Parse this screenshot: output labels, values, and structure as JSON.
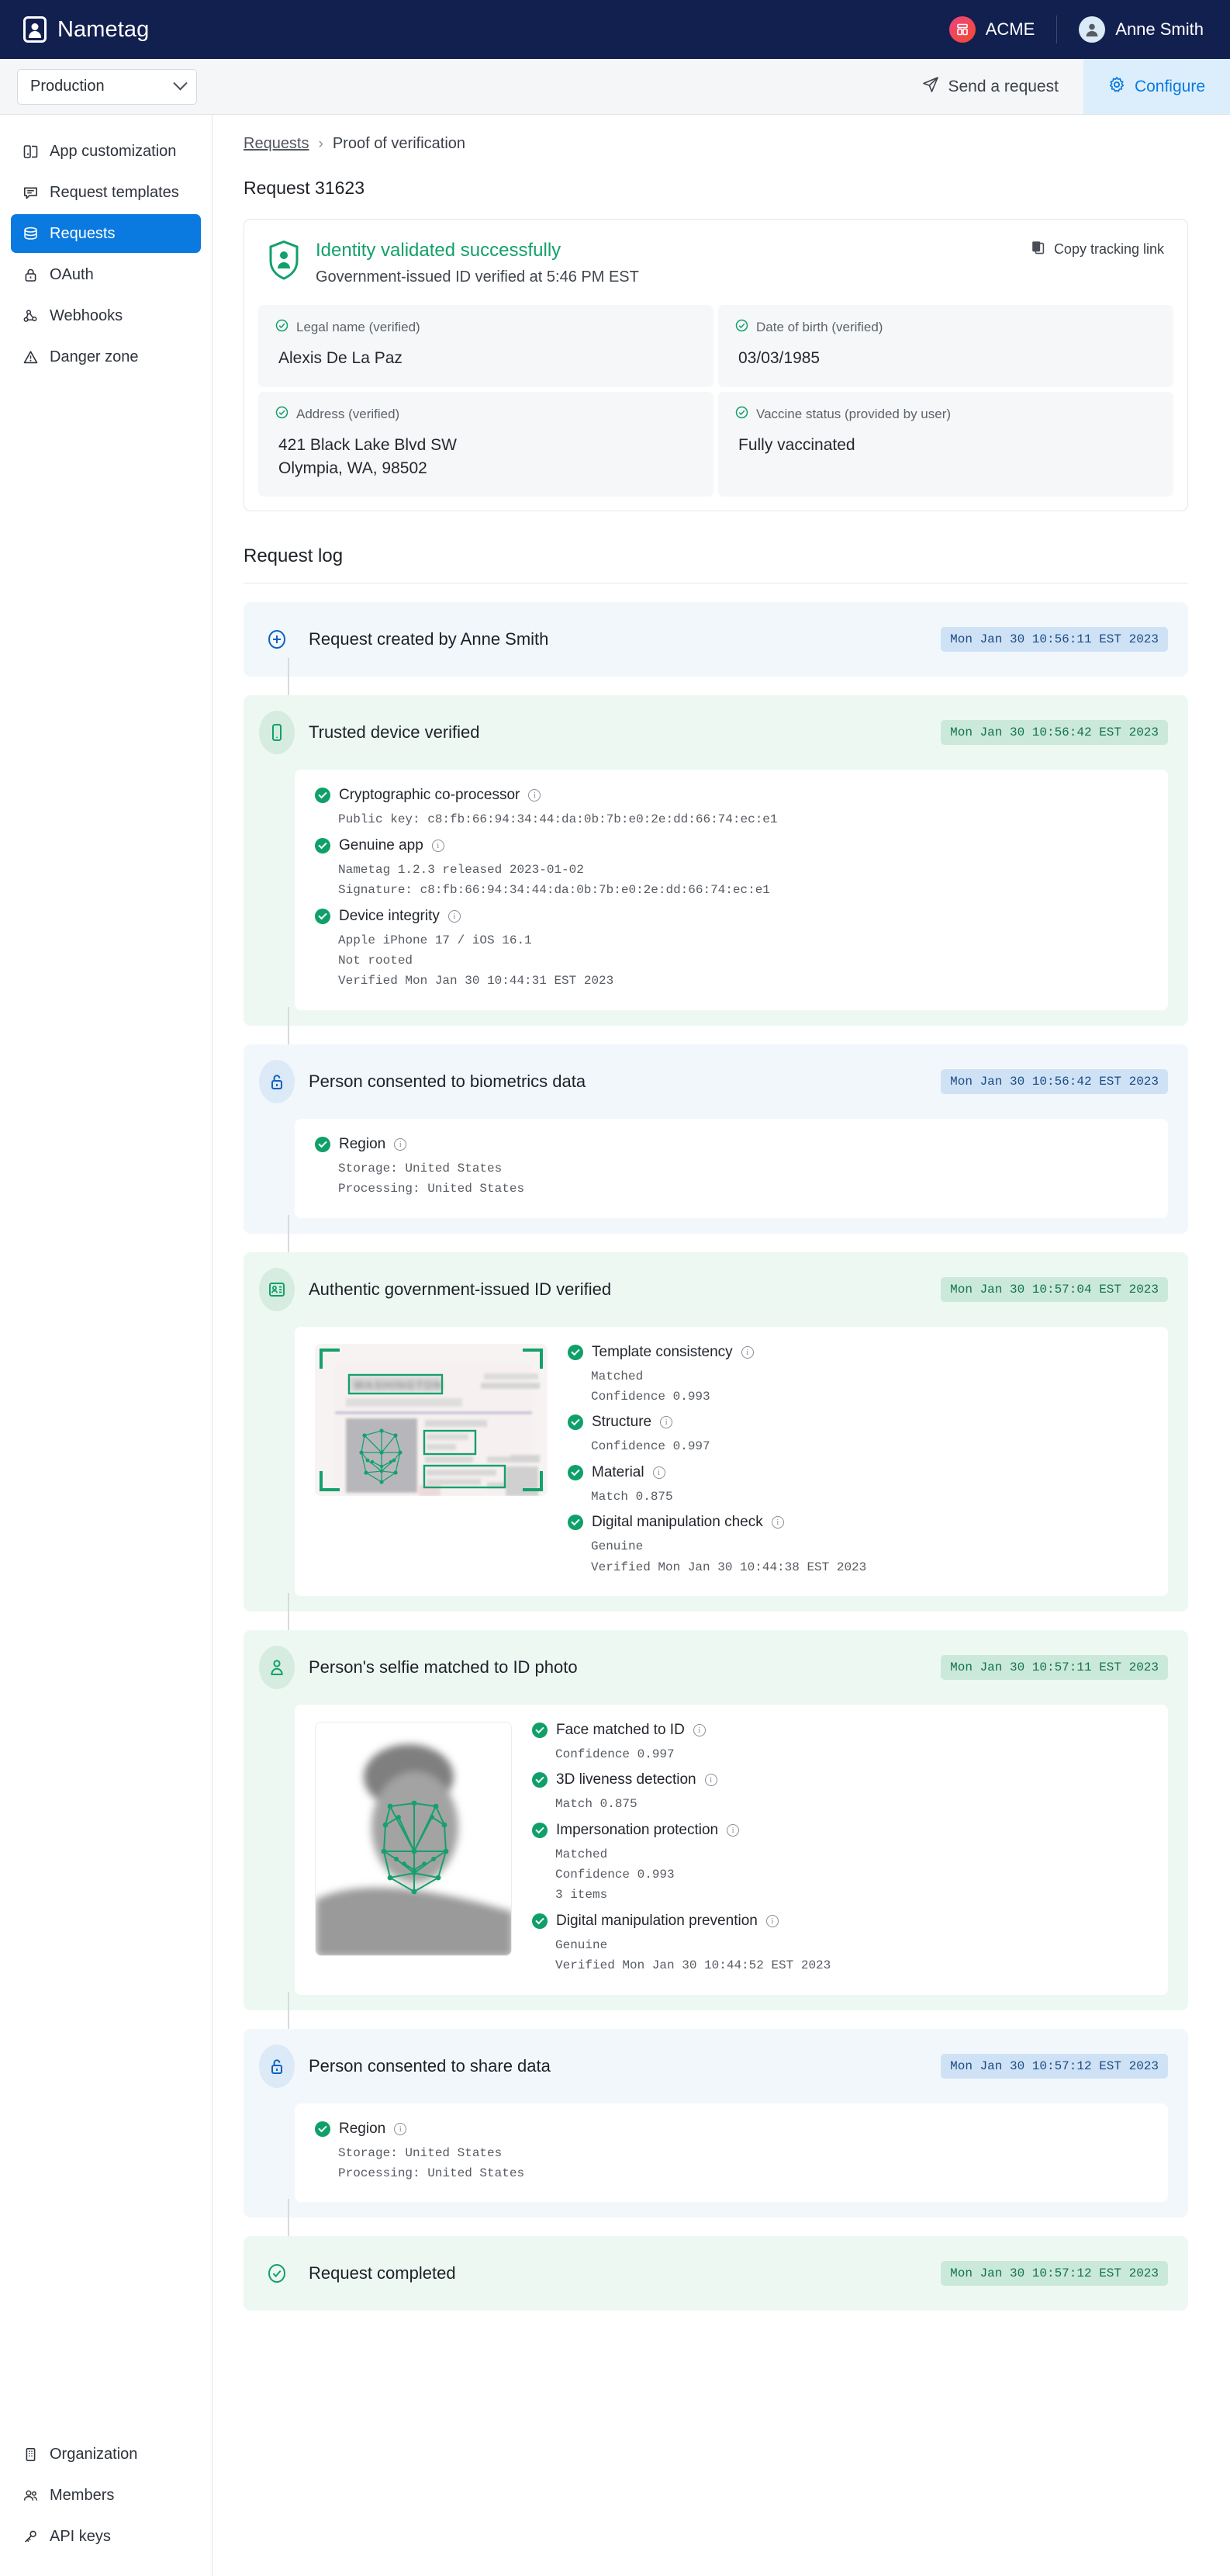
{
  "topbar": {
    "brand": "Nametag",
    "org": "ACME",
    "user": "Anne Smith"
  },
  "subbar": {
    "environment": "Production",
    "send_request": "Send a request",
    "configure": "Configure"
  },
  "sidebar": {
    "items": [
      {
        "label": "App customization",
        "icon": "layout-icon",
        "active": false
      },
      {
        "label": "Request templates",
        "icon": "message-icon",
        "active": false
      },
      {
        "label": "Requests",
        "icon": "database-icon",
        "active": true
      },
      {
        "label": "OAuth",
        "icon": "lock-icon",
        "active": false
      },
      {
        "label": "Webhooks",
        "icon": "webhook-icon",
        "active": false
      },
      {
        "label": "Danger zone",
        "icon": "warning-icon",
        "active": false
      }
    ],
    "bottom_items": [
      {
        "label": "Organization",
        "icon": "building-icon"
      },
      {
        "label": "Members",
        "icon": "people-icon"
      },
      {
        "label": "API keys",
        "icon": "key-icon"
      }
    ]
  },
  "breadcrumb": {
    "root": "Requests",
    "separator": "›",
    "current": "Proof of verification"
  },
  "page_title": "Request 31623",
  "verification_card": {
    "title": "Identity validated successfully",
    "subtitle": "Government-issued ID verified at 5:46 PM EST",
    "copy_link": "Copy tracking link",
    "fields": [
      {
        "label": "Legal name (verified)",
        "value": "Alexis De La Paz"
      },
      {
        "label": "Date of birth (verified)",
        "value": "03/03/1985"
      },
      {
        "label": "Address (verified)",
        "value": "421 Black Lake Blvd SW\nOlympia, WA, 98502"
      },
      {
        "label": "Vaccine status (provided by user)",
        "value": "Fully vaccinated"
      }
    ]
  },
  "request_log": {
    "section_title": "Request log",
    "events": [
      {
        "id": "request-created",
        "title": "Request created by Anne Smith",
        "time": "Mon Jan 30 10:56:11 EST 2023",
        "tone": "blue",
        "icon": "plus-circle-icon",
        "checks": []
      },
      {
        "id": "trusted-device",
        "title": "Trusted device verified",
        "time": "Mon Jan 30 10:56:42 EST 2023",
        "tone": "green",
        "icon": "phone-icon",
        "checks": [
          {
            "label": "Cryptographic co-processor",
            "lines": [
              "Public key: c8:fb:66:94:34:44:da:0b:7b:e0:2e:dd:66:74:ec:e1"
            ]
          },
          {
            "label": "Genuine app",
            "lines": [
              "Nametag 1.2.3 released 2023-01-02",
              "Signature: c8:fb:66:94:34:44:da:0b:7b:e0:2e:dd:66:74:ec:e1"
            ]
          },
          {
            "label": "Device integrity",
            "lines": [
              "Apple iPhone 17 / iOS 16.1",
              "Not rooted",
              "Verified Mon Jan 30 10:44:31 EST 2023"
            ]
          }
        ]
      },
      {
        "id": "consent-biometrics",
        "title": "Person consented to biometrics data",
        "time": "Mon Jan 30 10:56:42 EST 2023",
        "tone": "blue",
        "icon": "unlock-icon",
        "checks": [
          {
            "label": "Region",
            "lines": [
              "Storage: United States",
              "Processing: United States"
            ]
          }
        ]
      },
      {
        "id": "gov-id-verified",
        "title": "Authentic government-issued ID verified",
        "time": "Mon Jan 30 10:57:04 EST 2023",
        "tone": "green",
        "icon": "id-card-icon",
        "thumb": "id-document",
        "checks": [
          {
            "label": "Template consistency",
            "lines": [
              "Matched",
              "Confidence 0.993"
            ]
          },
          {
            "label": "Structure",
            "lines": [
              "Confidence 0.997"
            ]
          },
          {
            "label": "Material",
            "lines": [
              "Match 0.875"
            ]
          },
          {
            "label": "Digital manipulation check",
            "lines": [
              "Genuine",
              "Verified Mon Jan 30 10:44:38 EST 2023"
            ]
          }
        ]
      },
      {
        "id": "selfie-matched",
        "title": "Person's selfie matched to ID photo",
        "time": "Mon Jan 30 10:57:11 EST 2023",
        "tone": "green",
        "icon": "person-icon",
        "thumb": "selfie",
        "checks": [
          {
            "label": "Face matched to ID",
            "lines": [
              "Confidence 0.997"
            ]
          },
          {
            "label": "3D liveness detection",
            "lines": [
              "Match 0.875"
            ]
          },
          {
            "label": "Impersonation protection",
            "lines": [
              "Matched",
              "Confidence 0.993",
              "3 items"
            ]
          },
          {
            "label": "Digital manipulation prevention",
            "lines": [
              "Genuine",
              "Verified Mon Jan 30 10:44:52 EST 2023"
            ]
          }
        ]
      },
      {
        "id": "consent-share",
        "title": "Person consented to share data",
        "time": "Mon Jan 30 10:57:12 EST 2023",
        "tone": "blue",
        "icon": "unlock-icon",
        "checks": [
          {
            "label": "Region",
            "lines": [
              "Storage: United States",
              "Processing: United States"
            ]
          }
        ]
      },
      {
        "id": "request-completed",
        "title": "Request completed",
        "time": "Mon Jan 30 10:57:12 EST 2023",
        "tone": "green",
        "icon": "check-circle-icon",
        "checks": []
      }
    ]
  },
  "id_document": {
    "state_header": "WASHINGTON"
  },
  "colors": {
    "navy": "#12204f",
    "accent_blue": "#0a7ae0",
    "success_green": "#12a06a",
    "green_bg": "#eef8f3",
    "blue_bg": "#f2f7fc"
  }
}
